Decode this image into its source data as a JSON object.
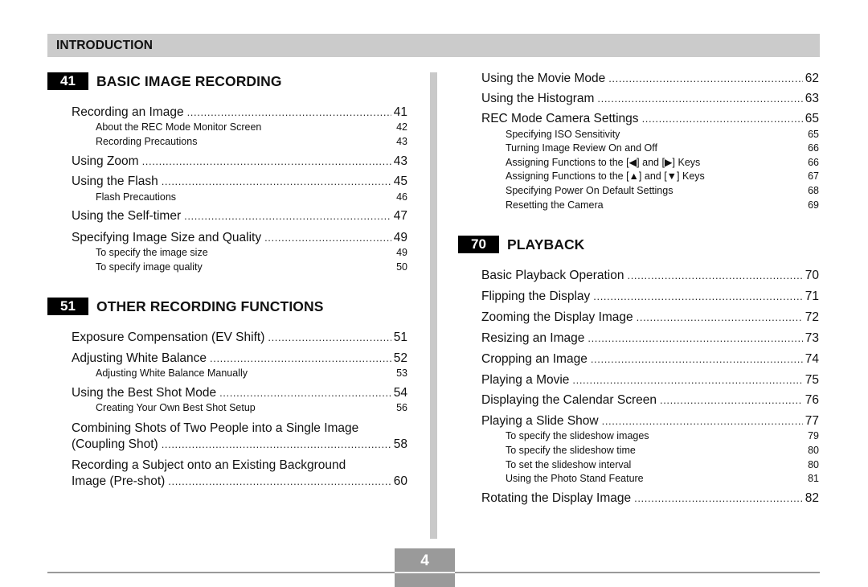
{
  "header": {
    "title": "INTRODUCTION"
  },
  "sections": [
    {
      "number": "41",
      "title": "BASIC IMAGE RECORDING",
      "entries": [
        {
          "label": "Recording an Image",
          "page": "41",
          "subs": [
            {
              "label": "About the REC Mode Monitor Screen",
              "page": "42"
            },
            {
              "label": "Recording Precautions",
              "page": "43"
            }
          ]
        },
        {
          "label": "Using Zoom",
          "page": "43",
          "subs": []
        },
        {
          "label": "Using the Flash",
          "page": "45",
          "subs": [
            {
              "label": "Flash Precautions",
              "page": "46"
            }
          ]
        },
        {
          "label": "Using the Self-timer",
          "page": "47",
          "subs": []
        },
        {
          "label": "Specifying Image Size and Quality",
          "page": "49",
          "subs": [
            {
              "label": "To specify the image size",
              "page": "49"
            },
            {
              "label": "To specify image quality",
              "page": "50"
            }
          ]
        }
      ]
    },
    {
      "number": "51",
      "title": "OTHER RECORDING FUNCTIONS",
      "entries": [
        {
          "label": "Exposure Compensation (EV Shift)",
          "page": "51",
          "subs": []
        },
        {
          "label": "Adjusting White Balance",
          "page": "52",
          "subs": [
            {
              "label": "Adjusting White Balance Manually",
              "page": "53"
            }
          ]
        },
        {
          "label": "Using the Best Shot Mode",
          "page": "54",
          "subs": [
            {
              "label": "Creating Your Own Best Shot Setup",
              "page": "56"
            }
          ]
        },
        {
          "label_line1": "Combining Shots of Two People into a Single Image",
          "label": "(Coupling Shot)",
          "page": "58",
          "subs": []
        },
        {
          "label_line1": "Recording a Subject onto an Existing Background",
          "label": "Image (Pre-shot)",
          "page": "60",
          "subs": []
        },
        {
          "label": "Using the Movie Mode",
          "page": "62",
          "subs": []
        },
        {
          "label": "Using the Histogram",
          "page": "63",
          "subs": []
        },
        {
          "label": "REC Mode Camera Settings",
          "page": "65",
          "subs": [
            {
              "label": "Specifying ISO Sensitivity",
              "page": "65"
            },
            {
              "label": "Turning Image Review On and Off",
              "page": "66"
            },
            {
              "label": "Assigning Functions to the [◀] and [▶] Keys",
              "page": "66"
            },
            {
              "label": "Assigning Functions to the [▲] and [▼] Keys",
              "page": "67"
            },
            {
              "label": "Specifying Power On Default Settings",
              "page": "68"
            },
            {
              "label": "Resetting the Camera",
              "page": "69"
            }
          ]
        }
      ]
    },
    {
      "number": "70",
      "title": "PLAYBACK",
      "entries": [
        {
          "label": "Basic Playback Operation",
          "page": "70",
          "subs": []
        },
        {
          "label": "Flipping the Display",
          "page": "71",
          "subs": []
        },
        {
          "label": "Zooming the Display Image",
          "page": "72",
          "subs": []
        },
        {
          "label": "Resizing an Image",
          "page": "73",
          "subs": []
        },
        {
          "label": "Cropping an Image",
          "page": "74",
          "subs": []
        },
        {
          "label": "Playing a Movie",
          "page": "75",
          "subs": []
        },
        {
          "label": "Displaying the Calendar Screen",
          "page": "76",
          "subs": []
        },
        {
          "label": "Playing a Slide Show",
          "page": "77",
          "subs": [
            {
              "label": "To specify the slideshow images",
              "page": "79"
            },
            {
              "label": "To specify the slideshow time",
              "page": "80"
            },
            {
              "label": "To set the slideshow interval",
              "page": "80"
            },
            {
              "label": "Using the Photo Stand Feature",
              "page": "81"
            }
          ]
        },
        {
          "label": "Rotating the Display Image",
          "page": "82",
          "subs": []
        }
      ]
    }
  ],
  "footer": {
    "page_number": "4"
  }
}
